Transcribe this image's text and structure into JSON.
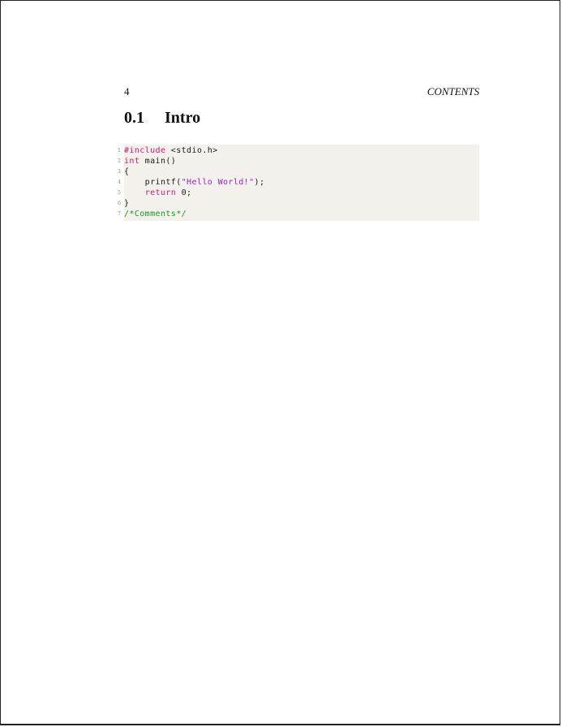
{
  "header": {
    "page_number": "4",
    "running_title": "CONTENTS"
  },
  "section": {
    "number": "0.1",
    "title": "Intro"
  },
  "code": {
    "lines": [
      {
        "n": "1",
        "parts": [
          {
            "t": "#include",
            "c": "kw"
          },
          {
            "t": " <stdio.h>",
            "c": "plain"
          }
        ]
      },
      {
        "n": "2",
        "parts": [
          {
            "t": "int",
            "c": "kw"
          },
          {
            "t": " main()",
            "c": "plain"
          }
        ]
      },
      {
        "n": "3",
        "parts": [
          {
            "t": "{",
            "c": "plain"
          }
        ]
      },
      {
        "n": "4",
        "parts": [
          {
            "t": "    printf(",
            "c": "plain"
          },
          {
            "t": "\"Hello World!\"",
            "c": "str"
          },
          {
            "t": ");",
            "c": "plain"
          }
        ]
      },
      {
        "n": "5",
        "parts": [
          {
            "t": "    ",
            "c": "plain"
          },
          {
            "t": "return",
            "c": "kw"
          },
          {
            "t": " 0;",
            "c": "plain"
          }
        ]
      },
      {
        "n": "6",
        "parts": [
          {
            "t": "}",
            "c": "plain"
          }
        ]
      },
      {
        "n": "7",
        "parts": [
          {
            "t": "/*Comments*/",
            "c": "com"
          }
        ]
      }
    ],
    "colors": {
      "keyword": "#d6177a",
      "string": "#a020c8",
      "comment": "#1a9a1a",
      "background": "#f2f1ec"
    }
  }
}
